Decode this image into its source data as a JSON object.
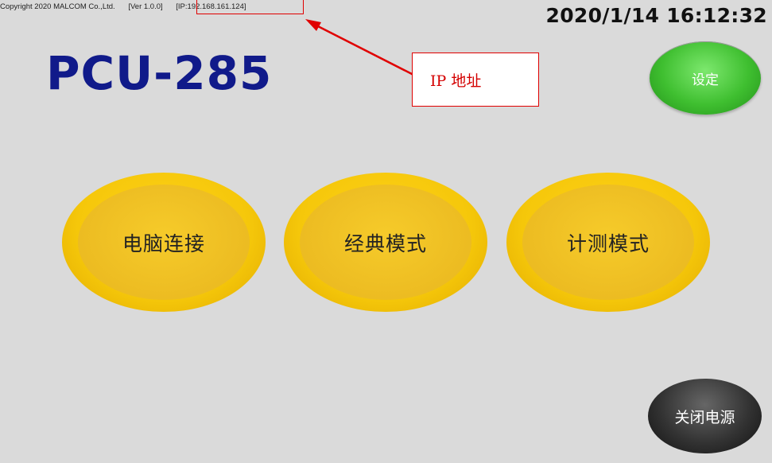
{
  "header": {
    "copyright": "Copyright 2020 MALCOM Co.,Ltd.",
    "version": "[Ver 1.0.0]",
    "ip": "[IP:192.168.161.124]",
    "datetime": "2020/1/14 16:12:32"
  },
  "model": "PCU-285",
  "annotation": {
    "label": "IP 地址",
    "color": "#e00000"
  },
  "buttons": {
    "settings": "设定",
    "pc_connect": "电脑连接",
    "classic_mode": "经典模式",
    "measure_mode": "计测模式",
    "power_off": "关闭电源"
  },
  "colors": {
    "background": "#dadada",
    "title": "#101a8a",
    "mode_button": "#f5c70a",
    "settings_button": "#3fbf30",
    "power_button": "#333333"
  }
}
